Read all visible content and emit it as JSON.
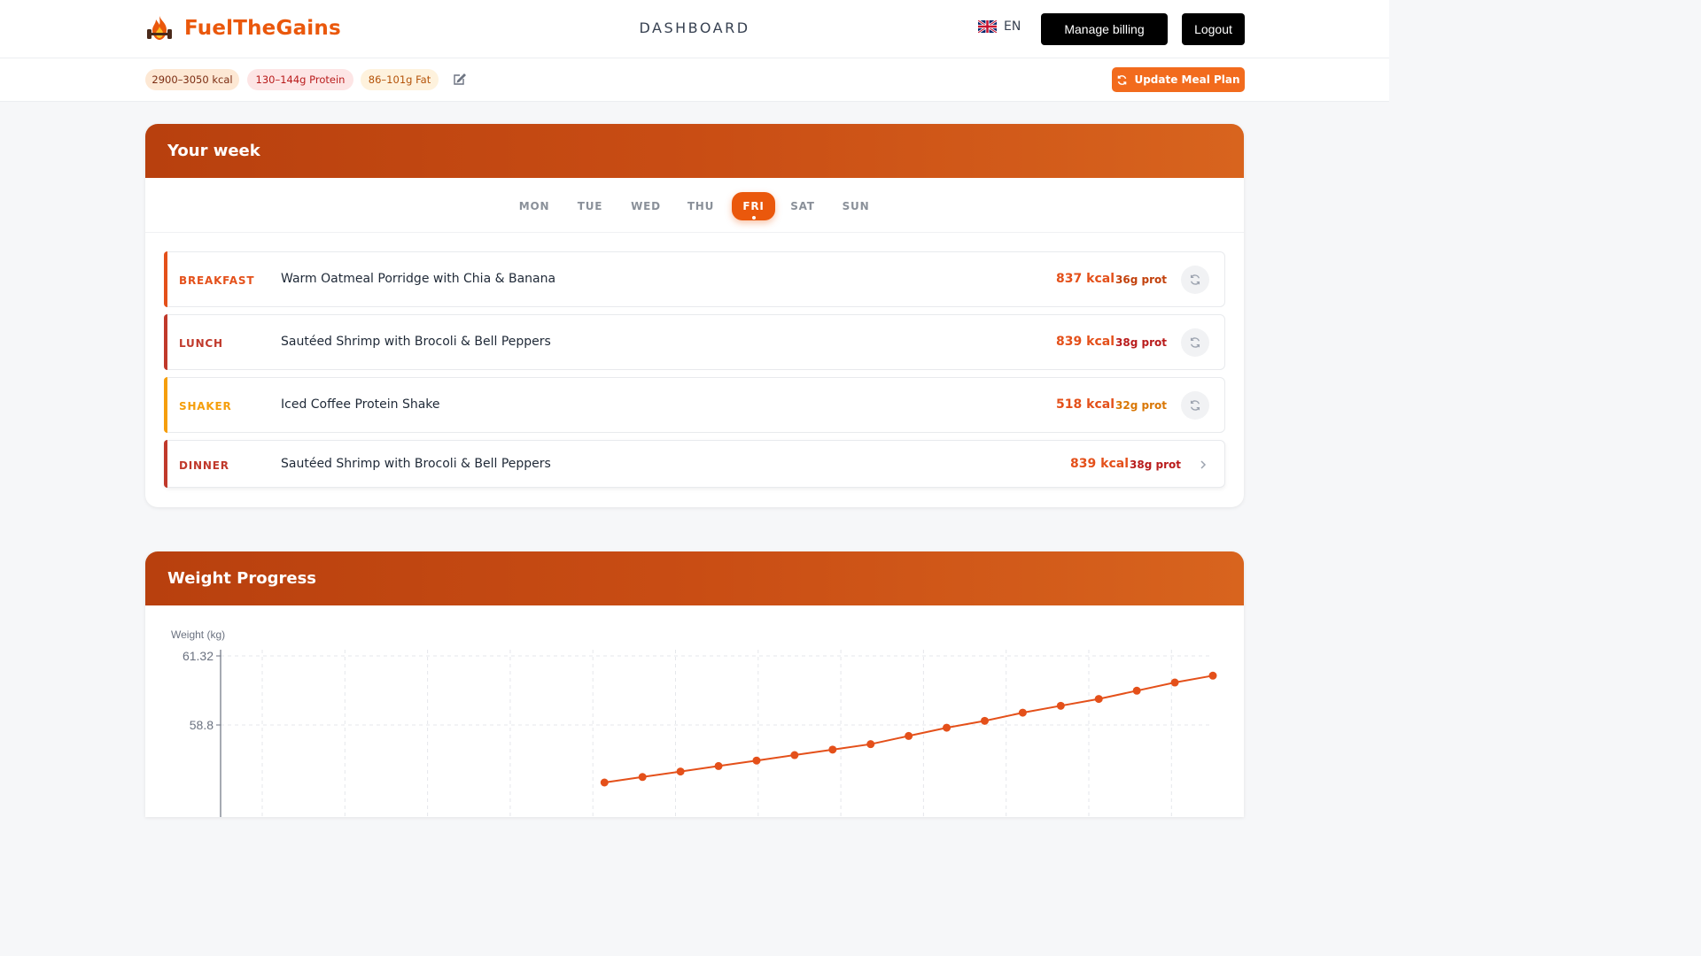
{
  "app": {
    "name": "FuelTheGains",
    "nav_title": "DASHBOARD"
  },
  "header": {
    "language": "EN",
    "billing_label": "Manage billing",
    "logout_label": "Logout"
  },
  "targets": {
    "kcal": "2900–3050 kcal",
    "protein": "130–144g Protein",
    "fat": "86–101g Fat",
    "update_label": "Update Meal Plan"
  },
  "week": {
    "title": "Your week",
    "days": [
      "MON",
      "TUE",
      "WED",
      "THU",
      "FRI",
      "SAT",
      "SUN"
    ],
    "active_day": "FRI",
    "meals": [
      {
        "type": "BREAKFAST",
        "name": "Warm Oatmeal Porridge with Chia & Banana",
        "kcal": "837 kcal",
        "protein": "36g prot"
      },
      {
        "type": "LUNCH",
        "name": "Sautéed Shrimp with Brocoli & Bell Peppers",
        "kcal": "839 kcal",
        "protein": "38g prot"
      },
      {
        "type": "SHAKER",
        "name": "Iced Coffee Protein Shake",
        "kcal": "518 kcal",
        "protein": "32g prot"
      },
      {
        "type": "DINNER",
        "name": "Sautéed Shrimp with Brocoli & Bell Peppers",
        "kcal": "839 kcal",
        "protein": "38g prot"
      }
    ],
    "colors": {
      "breakfast": "#e4501a",
      "lunch": "#c0392b",
      "shaker": "#f59e0b",
      "dinner": "#c0392b"
    }
  },
  "weight": {
    "title": "Weight Progress"
  },
  "chart_data": {
    "type": "line",
    "ylabel": "Weight (kg)",
    "y_ticks": [
      61.32,
      58.8
    ],
    "x": [
      0,
      1,
      2,
      3,
      4,
      5,
      6,
      7,
      8,
      9,
      10,
      11,
      12,
      13,
      14,
      15,
      16,
      17,
      18,
      19,
      20,
      21,
      22,
      23,
      24,
      25
    ],
    "values": [
      null,
      null,
      null,
      null,
      null,
      null,
      null,
      null,
      null,
      56.7,
      56.9,
      57.1,
      57.3,
      57.5,
      57.7,
      57.9,
      58.1,
      58.4,
      58.7,
      58.95,
      59.25,
      59.5,
      59.75,
      60.05,
      60.35,
      60.6
    ],
    "grid": true,
    "line_color": "#e4501a"
  }
}
